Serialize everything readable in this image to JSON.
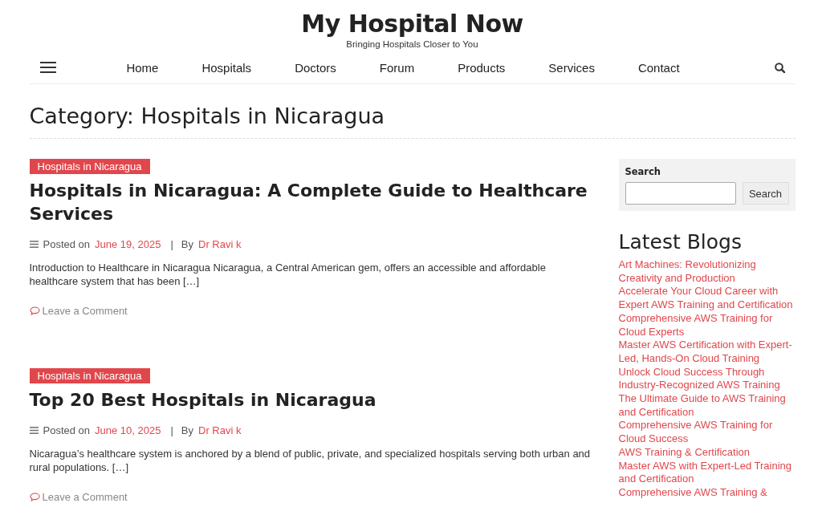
{
  "site": {
    "title": "My Hospital Now",
    "tagline": "Bringing Hospitals Closer to You"
  },
  "nav": {
    "items": [
      {
        "label": "Home"
      },
      {
        "label": "Hospitals"
      },
      {
        "label": "Doctors"
      },
      {
        "label": "Forum"
      },
      {
        "label": "Products"
      },
      {
        "label": "Services"
      },
      {
        "label": "Contact"
      }
    ]
  },
  "page_title": "Category: Hospitals in Nicaragua",
  "posts": [
    {
      "category": "Hospitals in Nicaragua",
      "title": "Hospitals in Nicaragua: A Complete Guide to Healthcare Services",
      "posted_label": "Posted on",
      "date": "June 19, 2025",
      "separator": "|",
      "by_label": "By",
      "author": "Dr Ravi k",
      "excerpt": "Introduction to Healthcare in Nicaragua Nicaragua, a Central American gem, offers an accessible and affordable healthcare system that has been […]",
      "comment_link": "Leave a Comment"
    },
    {
      "category": "Hospitals in Nicaragua",
      "title": "Top 20 Best Hospitals in Nicaragua",
      "posted_label": "Posted on",
      "date": "June 10, 2025",
      "separator": "|",
      "by_label": "By",
      "author": "Dr Ravi k",
      "excerpt": "Nicaragua’s healthcare system is anchored by a blend of public, private, and specialized hospitals serving both urban and rural populations. […]",
      "comment_link": "Leave a Comment"
    }
  ],
  "sidebar": {
    "search": {
      "label": "Search",
      "button": "Search"
    },
    "latest_blogs": {
      "heading": "Latest Blogs",
      "items": [
        "Art Machines: Revolutionizing Creativity and Production",
        "Accelerate Your Cloud Career with Expert AWS Training and Certification",
        "Comprehensive AWS Training for Cloud Experts",
        "Master AWS Certification with Expert-Led, Hands-On Cloud Training",
        "Unlock Cloud Success Through Industry-Recognized AWS Training",
        "The Ultimate Guide to AWS Training and Certification",
        "Comprehensive AWS Training for Cloud Success",
        "AWS Training & Certification",
        "Master AWS with Expert-Led Training and Certification",
        "Comprehensive AWS Training &"
      ]
    }
  }
}
